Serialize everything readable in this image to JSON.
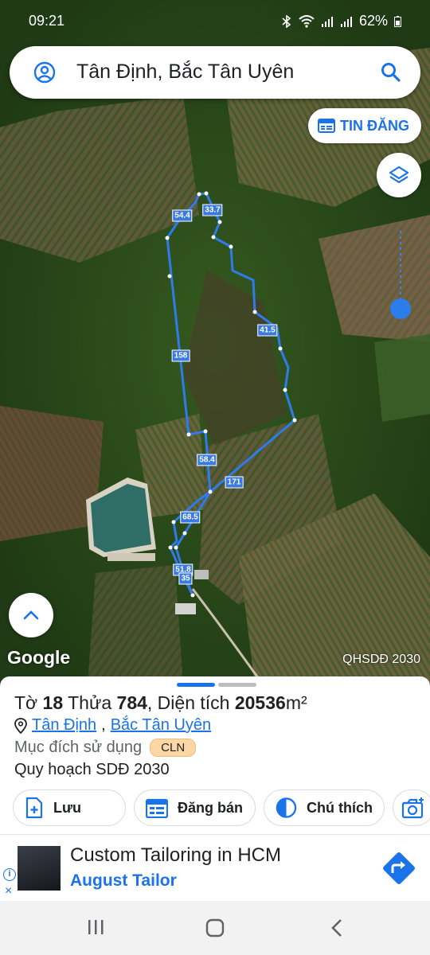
{
  "status_bar": {
    "time": "09:21",
    "battery": "62%"
  },
  "search": {
    "query": "Tân Định, Bắc Tân Uyên"
  },
  "map": {
    "tin_dang_label": "TIN ĐĂNG",
    "provider": "Google",
    "layer_name": "QHSDĐ 2030",
    "segment_labels": [
      "54.4",
      "33.7",
      "158",
      "41.5",
      "58.4",
      "171",
      "68.5",
      "51.8",
      "35"
    ]
  },
  "parcel": {
    "sheet_prefix": "Tờ",
    "sheet_number": "18",
    "lot_prefix": "Thửa",
    "lot_number": "784",
    "area_prefix": ", Diện tích",
    "area_value": "20536",
    "area_unit": "m²",
    "ward": "Tân Định",
    "district": "Bắc Tân Uyên",
    "usage_label": "Mục đích sử dụng",
    "usage_code": "CLN",
    "plan_label": "Quy hoạch SDĐ 2030"
  },
  "actions": {
    "save": "Lưu",
    "post_sale": "Đăng bán",
    "legend": "Chú thích"
  },
  "ad": {
    "title": "Custom Tailoring in HCM",
    "advertiser": "August Tailor",
    "info_icon": "i",
    "close_icon": "×"
  },
  "colors": {
    "accent": "#1a73e8",
    "boundary": "#2f7bea",
    "badge": "#fbd7a5"
  }
}
